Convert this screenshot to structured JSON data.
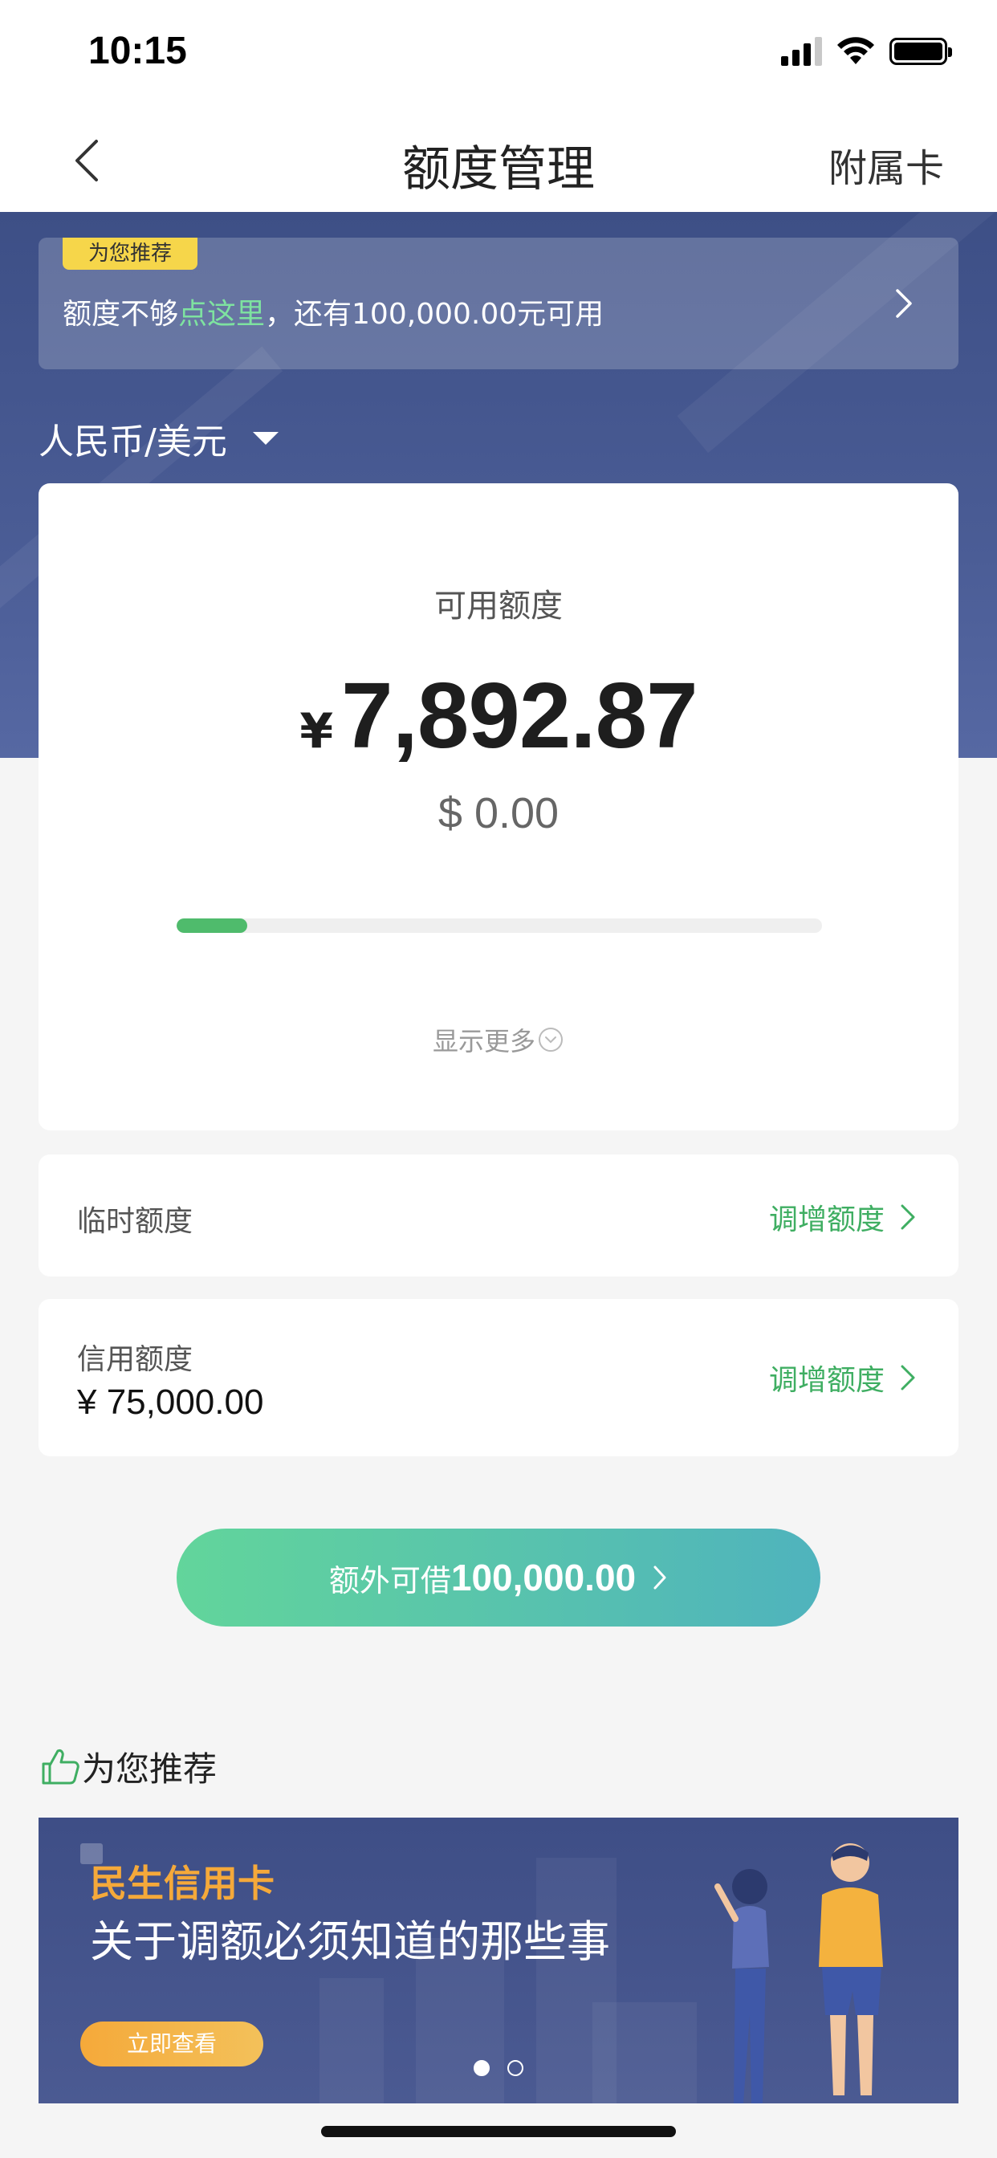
{
  "status_bar": {
    "time": "10:15"
  },
  "nav": {
    "title": "额度管理",
    "right_label": "附属卡"
  },
  "promo": {
    "badge": "为您推荐",
    "text_before": "额度不够",
    "text_link": "点这里",
    "text_after": "，还有100,000.00元可用"
  },
  "currency": {
    "label": "人民币/美元"
  },
  "available": {
    "label": "可用额度",
    "currency_symbol": "¥",
    "amount": "7,892.87",
    "usd": "$ 0.00",
    "usage_fraction": 0.11,
    "show_more": "显示更多"
  },
  "temporary": {
    "label": "临时额度",
    "action": "调增额度"
  },
  "credit": {
    "label": "信用额度",
    "value": "¥ 75,000.00",
    "action": "调增额度"
  },
  "cta": {
    "prefix": "额外可借",
    "amount": "100,000.00"
  },
  "recommend": {
    "title": "为您推荐",
    "banner": {
      "brand": "民生信用卡",
      "headline": "关于调额必须知道的那些事",
      "button": "立即查看"
    },
    "page_index": 0,
    "page_count": 2
  },
  "colors": {
    "accent_green": "#3fae62",
    "hero_blue": "#3d4f86",
    "badge_yellow": "#f6d64a",
    "banner_orange": "#f5a93a"
  }
}
